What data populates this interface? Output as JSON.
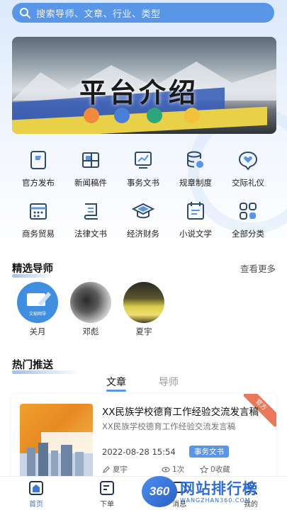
{
  "search": {
    "placeholder": "搜索导师、文章、行业、类型"
  },
  "banner": {
    "title": "平台介绍",
    "dots": [
      "#f08a3a",
      "#4a7fd6",
      "#2fa67a",
      "#f3c23a"
    ]
  },
  "categories": [
    {
      "label": "官方发布",
      "icon": "document-badge-icon"
    },
    {
      "label": "新闻稿件",
      "icon": "newspaper-icon"
    },
    {
      "label": "事务文书",
      "icon": "chart-board-icon"
    },
    {
      "label": "规章制度",
      "icon": "database-stack-icon"
    },
    {
      "label": "交际礼仪",
      "icon": "heart-chat-icon"
    },
    {
      "label": "商务贸易",
      "icon": "calendar-grid-icon"
    },
    {
      "label": "法律文书",
      "icon": "scroll-icon"
    },
    {
      "label": "经济财务",
      "icon": "graduation-cap-icon"
    },
    {
      "label": "小说文学",
      "icon": "book-calendar-icon"
    },
    {
      "label": "全部分类",
      "icon": "grid-apps-icon"
    }
  ],
  "mentors_section": {
    "title": "精选导师",
    "more": "查看更多",
    "mentors": [
      {
        "name": "关月",
        "avatar_text": "文秘网导"
      },
      {
        "name": "邓彪"
      },
      {
        "name": "夏宇"
      }
    ]
  },
  "hot_section": {
    "title": "热门推送",
    "tabs": [
      {
        "label": "文章",
        "active": true
      },
      {
        "label": "导师",
        "active": false
      }
    ]
  },
  "article": {
    "badge": "官方",
    "title": "XX民族学校德育工作经验交流发言稿",
    "subtitle": "XX民族学校德育工作经验交流发言稿",
    "date": "2022-08-28 15:54",
    "tag": "事务文书",
    "author": "夏宇",
    "views": "1次",
    "favorites": "0收藏"
  },
  "nav": [
    {
      "label": "首页",
      "icon": "home-icon",
      "active": true
    },
    {
      "label": "下单",
      "icon": "order-edit-icon",
      "active": false
    },
    {
      "label": "消息",
      "icon": "message-icon",
      "active": false
    },
    {
      "label": "我的",
      "icon": "user-icon",
      "active": false
    }
  ],
  "watermark": {
    "logo": "360",
    "name": "网站排行榜",
    "domain": "WANGZHAN360.COM"
  },
  "colors": {
    "accent": "#5a96e8",
    "nav_active": "#3a78d6",
    "badge": "#e9795a"
  }
}
